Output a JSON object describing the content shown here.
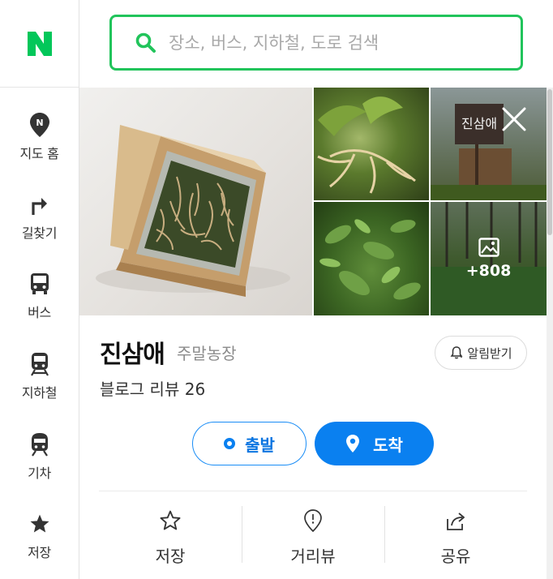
{
  "search": {
    "placeholder": "장소, 버스, 지하철, 도로 검색"
  },
  "nav": {
    "logo": "N",
    "items": [
      {
        "label": "지도 홈",
        "icon": "map-pin-icon"
      },
      {
        "label": "길찾기",
        "icon": "route-arrow-icon"
      },
      {
        "label": "버스",
        "icon": "bus-icon"
      },
      {
        "label": "지하철",
        "icon": "subway-icon"
      },
      {
        "label": "기차",
        "icon": "train-icon"
      },
      {
        "label": "저장",
        "icon": "star-icon"
      }
    ]
  },
  "place": {
    "name": "진삼애",
    "category": "주말농장",
    "reviews": "블로그 리뷰 26",
    "alarm_label": "알림받기",
    "photo_more": "+808",
    "start_label": "출발",
    "arrive_label": "도착",
    "actions": [
      {
        "label": "저장",
        "icon": "star-outline-icon"
      },
      {
        "label": "거리뷰",
        "icon": "street-view-icon"
      },
      {
        "label": "공유",
        "icon": "share-icon"
      }
    ]
  },
  "colors": {
    "brand_green": "#21c45b",
    "accent_blue": "#0a80f0"
  }
}
